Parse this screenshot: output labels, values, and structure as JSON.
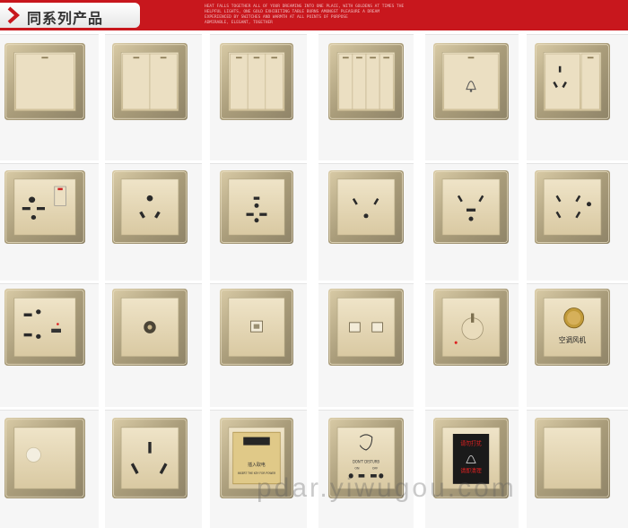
{
  "header": {
    "title": "同系列产品",
    "tagline": "HEAT FALLS TOGETHER ALL OF YOUR DREAMING INTO ONE PLACE, WITH GOLDENS AT TIMES THE\nHELPFUL LIGHTS, ONE GOLD EXHIBITING TABLE BURNS AMONGST PLEASURE A DREAM\nEXPERIENCED BY SWITCHES AND WARMTH AT ALL POINTS OF PURPOSE\nADMIRABLE, ELEGANT, TOGETHER"
  },
  "products": {
    "ac_switch_label": "空调风机",
    "card_slot_line1": "插入取电",
    "card_slot_line2": "INSERT THE KEY FOR POWER",
    "dnd_label": "DON'T DISTURB",
    "dnd_on": "ON",
    "dnd_off": "OFF",
    "hotel_red_top": "请勿打扰",
    "hotel_red_bottom": "请即清理"
  },
  "watermark": "pdar.yiwugou.com",
  "colors": {
    "header_red": "#c8171d",
    "frame_gold": "#c2b48c",
    "plate_champagne": "#e4d6b5",
    "key_face": "#e9dcbd"
  }
}
